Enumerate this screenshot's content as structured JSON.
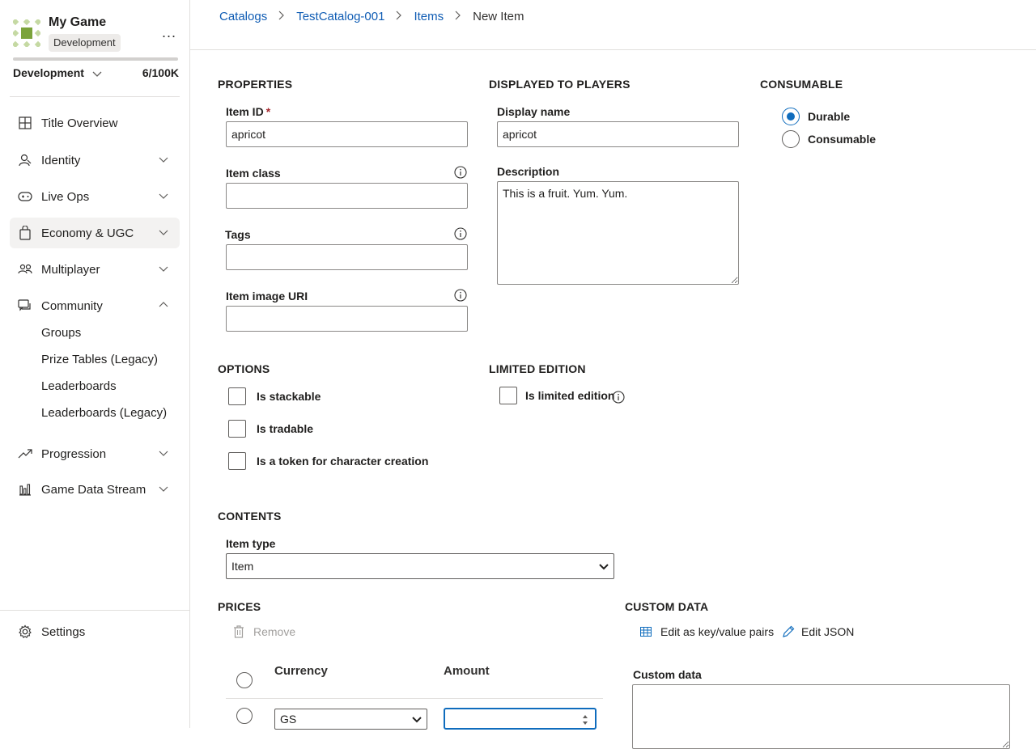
{
  "sidebar": {
    "game_name": "My Game",
    "env_badge": "Development",
    "more_label": "...",
    "usage_fraction": 6e-05,
    "environment": "Development",
    "count": "6/100K",
    "nav": [
      {
        "label": "Title Overview",
        "icon": "grid-icon"
      },
      {
        "label": "Identity",
        "icon": "identity-icon"
      },
      {
        "label": "Live Ops",
        "icon": "gamepad-icon"
      },
      {
        "label": "Economy & UGC",
        "icon": "shopping-bag-icon"
      },
      {
        "label": "Multiplayer",
        "icon": "people-icon"
      },
      {
        "label": "Community",
        "icon": "chat-icon"
      },
      {
        "label": "Progression",
        "icon": "trending-up-icon"
      },
      {
        "label": "Game Data Stream",
        "icon": "bar-chart-icon"
      }
    ],
    "community_items": [
      "Groups",
      "Prize Tables (Legacy)",
      "Leaderboards",
      "Leaderboards (Legacy)"
    ],
    "settings": "Settings"
  },
  "breadcrumb": {
    "catalogs": "Catalogs",
    "catalog": "TestCatalog-001",
    "items": "Items",
    "current": "New Item",
    "separator": ">"
  },
  "properties": {
    "title": "PROPERTIES",
    "item_id_label": "Item ID",
    "required_mark": "*",
    "item_id_value": "apricot",
    "item_class_label": "Item class",
    "item_class_value": "",
    "tags_label": "Tags",
    "tags_value": "",
    "image_uri_label": "Item image URI",
    "image_uri_value": ""
  },
  "displayed": {
    "title": "DISPLAYED TO PLAYERS",
    "display_name_label": "Display name",
    "display_name_value": "apricot",
    "description_label": "Description",
    "description_value": "This is a fruit. Yum. Yum."
  },
  "consumable": {
    "title": "CONSUMABLE",
    "options": [
      "Durable",
      "Consumable"
    ],
    "selected": "Durable"
  },
  "options": {
    "title": "OPTIONS",
    "stackable": "Is stackable",
    "tradable": "Is tradable",
    "token": "Is a token for character creation"
  },
  "limited": {
    "title": "LIMITED EDITION",
    "label": "Is limited edition"
  },
  "contents": {
    "title": "CONTENTS",
    "item_type_label": "Item type",
    "item_type_value": "Item"
  },
  "prices": {
    "title": "PRICES",
    "remove": "Remove",
    "currency_header": "Currency",
    "amount_header": "Amount",
    "row_currency": "GS",
    "row_amount": ""
  },
  "custom_data": {
    "title": "CUSTOM DATA",
    "edit_kv": "Edit as key/value pairs",
    "edit_json": "Edit JSON",
    "label": "Custom data",
    "value": ""
  },
  "colors": {
    "accent": "#0f6cbd",
    "link": "#0f5cb4",
    "logo_green": "#7ba33b"
  }
}
